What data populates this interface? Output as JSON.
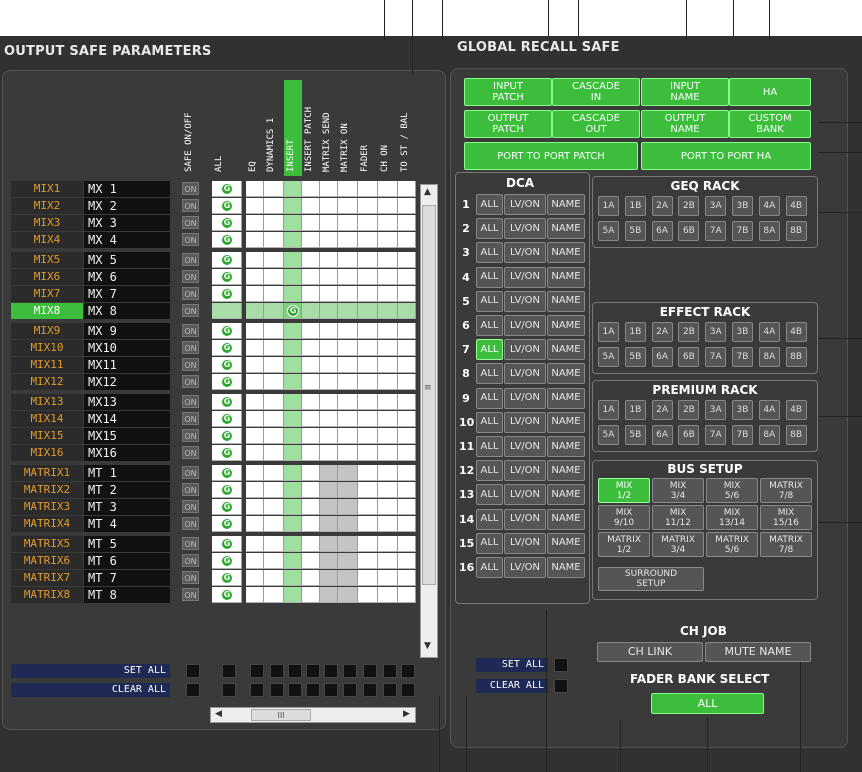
{
  "output_safe": {
    "title": "OUTPUT SAFE PARAMETERS",
    "columns": [
      "SAFE ON/OFF",
      "ALL",
      "EQ",
      "DYNAMICS 1",
      "INSERT",
      "INSERT PATCH",
      "MATRIX SEND",
      "MATRIX ON",
      "FADER",
      "CH ON",
      "TO ST / BAL"
    ],
    "rows": [
      {
        "name": "MIX1",
        "label": "MX 1",
        "g": "all"
      },
      {
        "name": "MIX2",
        "label": "MX 2",
        "g": "all"
      },
      {
        "name": "MIX3",
        "label": "MX 3",
        "g": "all"
      },
      {
        "name": "MIX4",
        "label": "MX 4",
        "g": "all"
      },
      {
        "name": "MIX5",
        "label": "MX 5",
        "g": "all"
      },
      {
        "name": "MIX6",
        "label": "MX 6",
        "g": "all"
      },
      {
        "name": "MIX7",
        "label": "MX 7",
        "g": "all"
      },
      {
        "name": "MIX8",
        "label": "MX 8",
        "g": "insert",
        "selected": true
      },
      {
        "name": "MIX9",
        "label": "MX 9",
        "g": "all"
      },
      {
        "name": "MIX10",
        "label": "MX10",
        "g": "all"
      },
      {
        "name": "MIX11",
        "label": "MX11",
        "g": "all"
      },
      {
        "name": "MIX12",
        "label": "MX12",
        "g": "all"
      },
      {
        "name": "MIX13",
        "label": "MX13",
        "g": "all"
      },
      {
        "name": "MIX14",
        "label": "MX14",
        "g": "all"
      },
      {
        "name": "MIX15",
        "label": "MX15",
        "g": "all"
      },
      {
        "name": "MIX16",
        "label": "MX16",
        "g": "all"
      },
      {
        "name": "MATRIX1",
        "label": "MT 1",
        "g": "all"
      },
      {
        "name": "MATRIX2",
        "label": "MT 2",
        "g": "all"
      },
      {
        "name": "MATRIX3",
        "label": "MT 3",
        "g": "all"
      },
      {
        "name": "MATRIX4",
        "label": "MT 4",
        "g": "all"
      },
      {
        "name": "MATRIX5",
        "label": "MT 5",
        "g": "all"
      },
      {
        "name": "MATRIX6",
        "label": "MT 6",
        "g": "all"
      },
      {
        "name": "MATRIX7",
        "label": "MT 7",
        "g": "all"
      },
      {
        "name": "MATRIX8",
        "label": "MT 8",
        "g": "all"
      }
    ],
    "on_label": "ON",
    "g_label": "G",
    "set_all": "SET ALL",
    "clear_all": "CLEAR ALL",
    "scroll_thumb": "III"
  },
  "global": {
    "title": "GLOBAL RECALL SAFE",
    "buttons": {
      "input_patch": "INPUT\nPATCH",
      "cascade_in": "CASCADE\nIN",
      "input_name": "INPUT\nNAME",
      "ha": "HA",
      "output_patch": "OUTPUT\nPATCH",
      "cascade_out": "CASCADE\nOUT",
      "output_name": "OUTPUT\nNAME",
      "custom_bank": "CUSTOM\nBANK",
      "port_patch": "PORT TO PORT PATCH",
      "port_ha": "PORT TO PORT HA"
    },
    "dca": {
      "title": "DCA",
      "numbers": [
        "1",
        "2",
        "3",
        "4",
        "5",
        "6",
        "7",
        "8",
        "9",
        "10",
        "11",
        "12",
        "13",
        "14",
        "15",
        "16"
      ],
      "all": "ALL",
      "lvon": "LV/ON",
      "name": "NAME",
      "all_on_row": 7
    },
    "geq": {
      "title": "GEQ RACK",
      "row1": [
        "1A",
        "1B",
        "2A",
        "2B",
        "3A",
        "3B",
        "4A",
        "4B"
      ],
      "row2": [
        "5A",
        "5B",
        "6A",
        "6B",
        "7A",
        "7B",
        "8A",
        "8B"
      ],
      "on": [
        "1A",
        "1B"
      ]
    },
    "effect": {
      "title": "EFFECT RACK",
      "row1": [
        "1A",
        "1B",
        "2A",
        "2B",
        "3A",
        "3B",
        "4A",
        "4B"
      ],
      "row2": [
        "5A",
        "5B",
        "6A",
        "6B",
        "7A",
        "7B",
        "8A",
        "8B"
      ],
      "on": [
        "4A",
        "4B"
      ]
    },
    "premium": {
      "title": "PREMIUM RACK",
      "row1": [
        "1A",
        "1B",
        "2A",
        "2B",
        "3A",
        "3B",
        "4A",
        "4B"
      ],
      "row2": [
        "5A",
        "5B",
        "6A",
        "6B",
        "7A",
        "7B",
        "8A",
        "8B"
      ],
      "on": [
        "8A",
        "8B"
      ]
    },
    "bus": {
      "title": "BUS SETUP",
      "row1": [
        "MIX\n1/2",
        "MIX\n3/4",
        "MIX\n5/6",
        "MATRIX\n7/8"
      ],
      "row2": [
        "MIX\n9/10",
        "MIX\n11/12",
        "MIX\n13/14",
        "MIX\n15/16"
      ],
      "row3": [
        "MATRIX\n1/2",
        "MATRIX\n3/4",
        "MATRIX\n5/6",
        "MATRIX\n7/8"
      ],
      "surround": "SURROUND\nSETUP"
    },
    "set_all": "SET ALL",
    "clear_all": "CLEAR ALL",
    "ch_job": {
      "title": "CH JOB",
      "ch_link": "CH LINK",
      "mute_name": "MUTE NAME"
    },
    "fader_bank": {
      "title": "FADER BANK SELECT",
      "all": "ALL"
    }
  },
  "colors": {
    "green": "#3cbe3c",
    "orange": "#e09a2c",
    "panel": "#313131"
  }
}
